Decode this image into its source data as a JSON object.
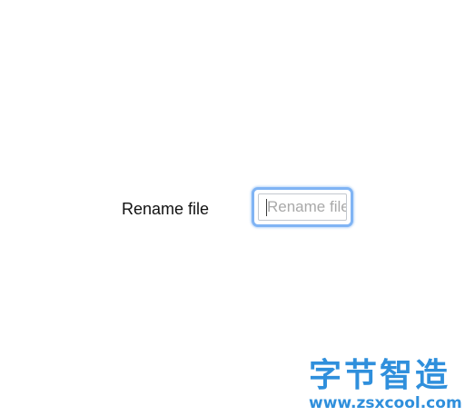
{
  "form": {
    "label": "Rename file",
    "input": {
      "value": "",
      "placeholder": "Rename file",
      "focused": true
    }
  },
  "watermark": {
    "title": "字节智造",
    "url": "www.zsxcool.com"
  },
  "colors": {
    "focus_ring": "#80b4f4",
    "watermark": "#2f8fdc",
    "placeholder": "#a9a9a9"
  }
}
